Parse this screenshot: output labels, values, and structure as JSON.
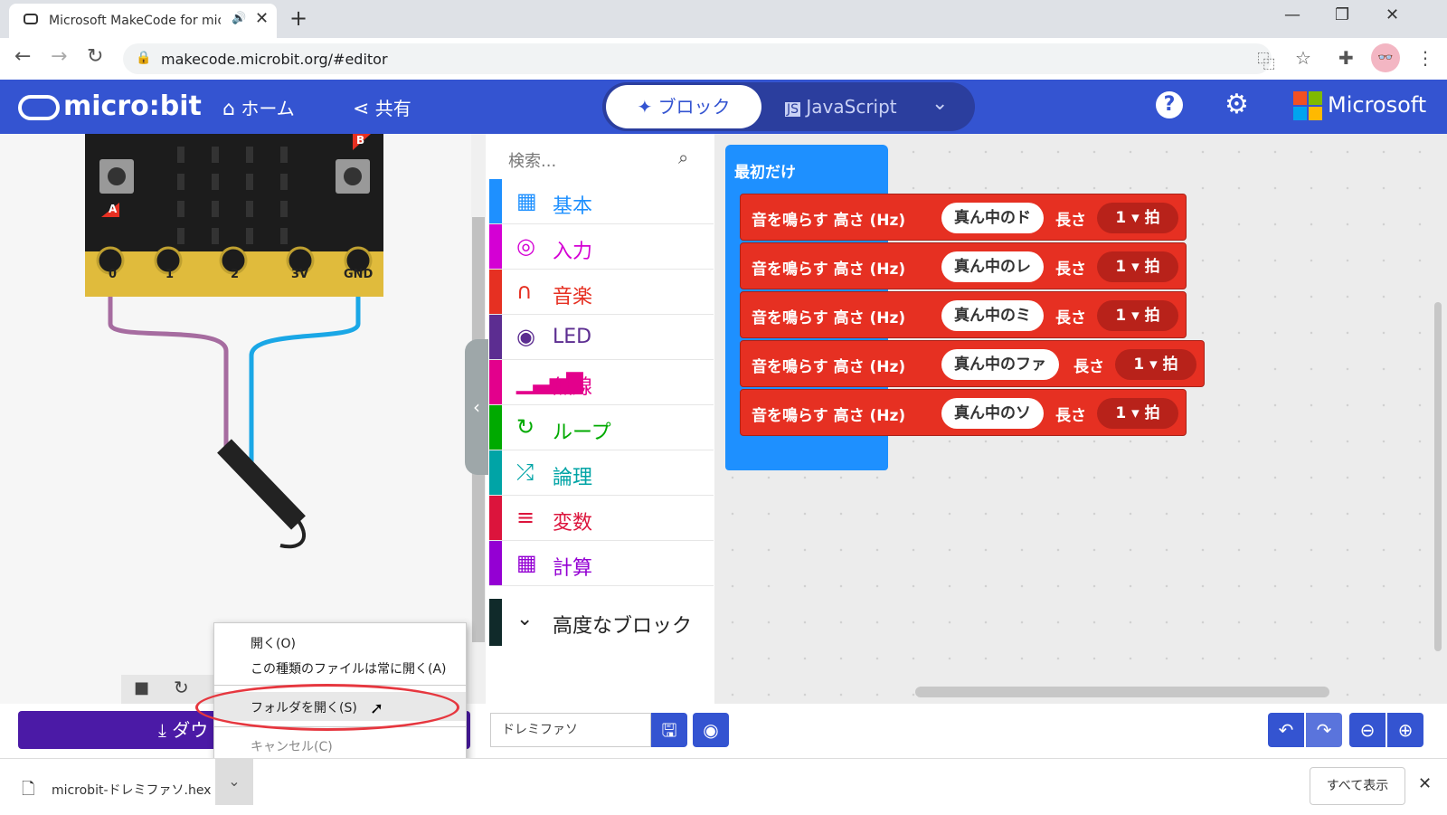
{
  "browser": {
    "tab_title": "Microsoft MakeCode for micro:bit",
    "url": "makecode.microbit.org/#editor",
    "new_tab": "+",
    "close_tab": "✕"
  },
  "header": {
    "logo_text": "micro:bit",
    "home_label": "ホーム",
    "share_label": "共有",
    "mode_blocks": "ブロック",
    "mode_js": "JavaScript",
    "help": "?",
    "brand": "Microsoft"
  },
  "simulator": {
    "pins": [
      "0",
      "1",
      "2",
      "3V",
      "GND"
    ],
    "button_a": "A",
    "button_b": "B",
    "download_label": "ダウ"
  },
  "toolbox": {
    "search_placeholder": "検索...",
    "categories": [
      {
        "label": "基本",
        "color": "#1e90ff",
        "icon": "grid-icon"
      },
      {
        "label": "入力",
        "color": "#d400d4",
        "icon": "target-icon"
      },
      {
        "label": "音楽",
        "color": "#e63022",
        "icon": "headphones-icon"
      },
      {
        "label": "LED",
        "color": "#5c2d91",
        "icon": "toggle-icon"
      },
      {
        "label": "無線",
        "color": "#e3008c",
        "icon": "signal-icon"
      },
      {
        "label": "ループ",
        "color": "#00aa00",
        "icon": "loop-icon"
      },
      {
        "label": "論理",
        "color": "#00a4a6",
        "icon": "shuffle-icon"
      },
      {
        "label": "変数",
        "color": "#dc143c",
        "icon": "lines-icon"
      },
      {
        "label": "計算",
        "color": "#9400d3",
        "icon": "calculator-icon"
      }
    ],
    "advanced": "高度なブロック"
  },
  "workspace": {
    "hat_label": "最初だけ",
    "blocks": [
      {
        "prefix": "音を鳴らす 高さ (Hz)",
        "note": "真ん中のド",
        "length_label": "長さ",
        "beat": "1",
        "unit": "拍"
      },
      {
        "prefix": "音を鳴らす 高さ (Hz)",
        "note": "真ん中のレ",
        "length_label": "長さ",
        "beat": "1",
        "unit": "拍"
      },
      {
        "prefix": "音を鳴らす 高さ (Hz)",
        "note": "真ん中のミ",
        "length_label": "長さ",
        "beat": "1",
        "unit": "拍"
      },
      {
        "prefix": "音を鳴らす 高さ (Hz)",
        "note": "真ん中のファ",
        "length_label": "長さ",
        "beat": "1",
        "unit": "拍"
      },
      {
        "prefix": "音を鳴らす 高さ (Hz)",
        "note": "真ん中のソ",
        "length_label": "長さ",
        "beat": "1",
        "unit": "拍"
      }
    ]
  },
  "bottombar": {
    "project_name": "ドレミファソ"
  },
  "context_menu": {
    "items": [
      "開く(O)",
      "この種類のファイルは常に開く(A)",
      "フォルダを開く(S)",
      "キャンセル(C)"
    ],
    "highlight_color": "#e6373f"
  },
  "download_shelf": {
    "file_name": "microbit-ドレミファソ.hex",
    "show_all": "すべて表示",
    "close": "✕"
  }
}
